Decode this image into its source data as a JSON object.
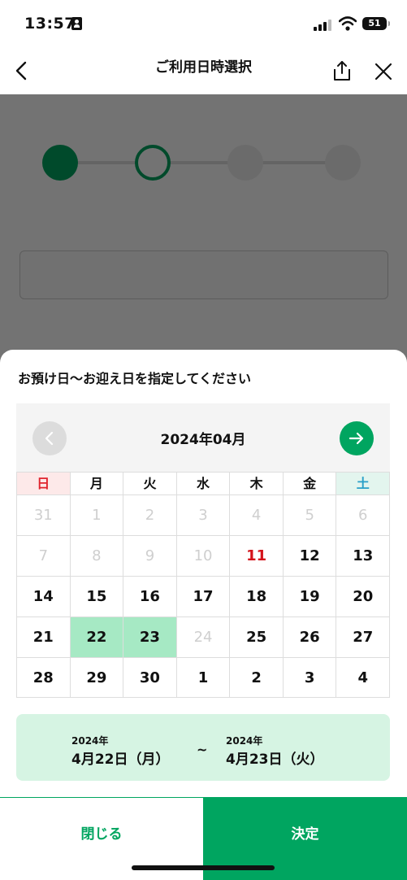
{
  "status_bar": {
    "time": "13:57",
    "battery": "51"
  },
  "nav": {
    "title": "ご利用日時選択"
  },
  "sheet": {
    "title": "お預け日〜お迎え日を指定してください",
    "calendar": {
      "month_label": "2024年04月",
      "weekdays": [
        "日",
        "月",
        "火",
        "水",
        "木",
        "金",
        "土"
      ],
      "weeks": [
        [
          {
            "d": "31",
            "s": "muted"
          },
          {
            "d": "1",
            "s": "muted"
          },
          {
            "d": "2",
            "s": "muted"
          },
          {
            "d": "3",
            "s": "muted"
          },
          {
            "d": "4",
            "s": "muted"
          },
          {
            "d": "5",
            "s": "muted"
          },
          {
            "d": "6",
            "s": "muted"
          }
        ],
        [
          {
            "d": "7",
            "s": "muted"
          },
          {
            "d": "8",
            "s": "muted"
          },
          {
            "d": "9",
            "s": "muted"
          },
          {
            "d": "10",
            "s": "muted"
          },
          {
            "d": "11",
            "s": "holiday"
          },
          {
            "d": "12",
            "s": "normal"
          },
          {
            "d": "13",
            "s": "normal"
          }
        ],
        [
          {
            "d": "14",
            "s": "normal"
          },
          {
            "d": "15",
            "s": "normal"
          },
          {
            "d": "16",
            "s": "normal"
          },
          {
            "d": "17",
            "s": "normal"
          },
          {
            "d": "18",
            "s": "normal"
          },
          {
            "d": "19",
            "s": "normal"
          },
          {
            "d": "20",
            "s": "normal"
          }
        ],
        [
          {
            "d": "21",
            "s": "normal"
          },
          {
            "d": "22",
            "s": "selected"
          },
          {
            "d": "23",
            "s": "selected"
          },
          {
            "d": "24",
            "s": "muted"
          },
          {
            "d": "25",
            "s": "normal"
          },
          {
            "d": "26",
            "s": "normal"
          },
          {
            "d": "27",
            "s": "normal"
          }
        ],
        [
          {
            "d": "28",
            "s": "normal"
          },
          {
            "d": "29",
            "s": "normal"
          },
          {
            "d": "30",
            "s": "normal"
          },
          {
            "d": "1",
            "s": "normal"
          },
          {
            "d": "2",
            "s": "normal"
          },
          {
            "d": "3",
            "s": "normal"
          },
          {
            "d": "4",
            "s": "normal"
          }
        ]
      ]
    },
    "range": {
      "start_year": "2024年",
      "start_date": "4月22日（月）",
      "separator": "~",
      "end_year": "2024年",
      "end_date": "4月23日（火）"
    },
    "buttons": {
      "close": "閉じる",
      "confirm": "決定"
    }
  },
  "colors": {
    "accent": "#00a560",
    "selected": "#a6e9c4",
    "range_bg": "#d6f4e3",
    "holiday": "#d4121a",
    "saturday": "#2aa0c8"
  }
}
